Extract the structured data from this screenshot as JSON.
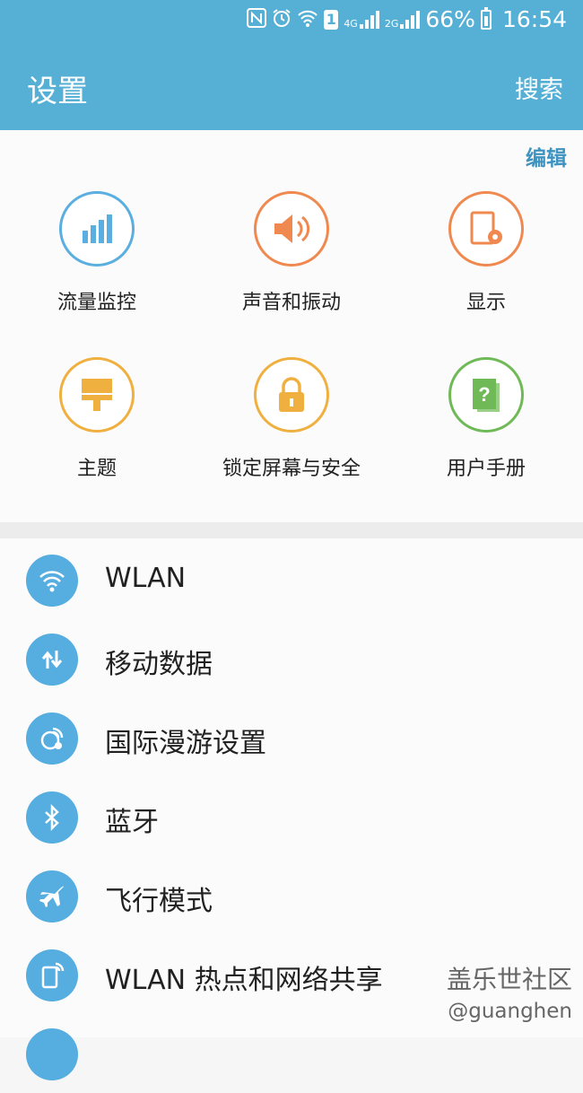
{
  "status_bar": {
    "battery_percent": "66%",
    "time": "16:54",
    "sim_badge": "1",
    "net1_label": "4G",
    "net2_label": "2G",
    "icons": [
      "nfc-icon",
      "alarm-icon",
      "wifi-icon",
      "sim-1-icon",
      "signal-4g-icon",
      "signal-2g-icon",
      "battery-icon"
    ]
  },
  "header": {
    "title": "设置",
    "search_label": "搜索"
  },
  "quick": {
    "edit_label": "编辑",
    "items": [
      {
        "label": "流量监控",
        "icon": "data-usage-icon",
        "color": "#5aaee0"
      },
      {
        "label": "声音和振动",
        "icon": "speaker-icon",
        "color": "#f0894f"
      },
      {
        "label": "显示",
        "icon": "display-settings-icon",
        "color": "#f0894f"
      },
      {
        "label": "主题",
        "icon": "paint-brush-icon",
        "color": "#f0b040"
      },
      {
        "label": "锁定屏幕与安全",
        "icon": "lock-icon",
        "color": "#f0b040"
      },
      {
        "label": "用户手册",
        "icon": "user-manual-icon",
        "color": "#6fba57"
      }
    ]
  },
  "list": {
    "items": [
      {
        "label": "WLAN",
        "icon": "wifi-icon"
      },
      {
        "label": "移动数据",
        "icon": "mobile-data-icon"
      },
      {
        "label": "国际漫游设置",
        "icon": "roaming-globe-icon"
      },
      {
        "label": "蓝牙",
        "icon": "bluetooth-icon"
      },
      {
        "label": "飞行模式",
        "icon": "airplane-icon"
      },
      {
        "label": "WLAN 热点和网络共享",
        "icon": "hotspot-icon"
      }
    ]
  },
  "watermark": {
    "line1": "盖乐世社区",
    "line2": "@guanghen"
  }
}
